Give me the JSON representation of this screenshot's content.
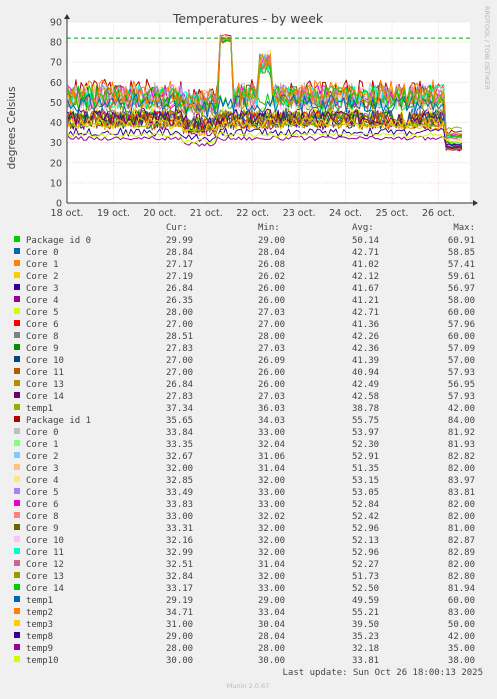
{
  "chart_data": {
    "type": "line",
    "title": "Temperatures - by week",
    "ylabel": "degrees Celsius",
    "xlabel": "",
    "side_label": "RRDTOOL / TOBI OETIKER",
    "ylim": [
      0,
      90
    ],
    "yticks": [
      0,
      10,
      20,
      30,
      40,
      50,
      60,
      70,
      80,
      90
    ],
    "x_ticks": [
      "18 oct.",
      "19 oct.",
      "20 oct.",
      "21 oct.",
      "22 oct.",
      "23 oct.",
      "24 oct.",
      "25 oct.",
      "26 oct."
    ],
    "grid": true,
    "threshold": 82,
    "columns": [
      "",
      "Cur:",
      "Min:",
      "Avg:",
      "Max:"
    ],
    "series": [
      {
        "name": "Package id 0",
        "color": "#00cc00",
        "cur": "29.99",
        "min": "29.00",
        "avg": "50.14",
        "max": "60.91"
      },
      {
        "name": "Core 0",
        "color": "#0066b3",
        "cur": "28.84",
        "min": "28.04",
        "avg": "42.71",
        "max": "58.85"
      },
      {
        "name": "Core 1",
        "color": "#ff8000",
        "cur": "27.17",
        "min": "26.08",
        "avg": "41.02",
        "max": "57.41"
      },
      {
        "name": "Core 2",
        "color": "#ffcc00",
        "cur": "27.19",
        "min": "26.02",
        "avg": "42.12",
        "max": "59.61"
      },
      {
        "name": "Core 3",
        "color": "#330099",
        "cur": "26.84",
        "min": "26.00",
        "avg": "41.67",
        "max": "56.97"
      },
      {
        "name": "Core 4",
        "color": "#990099",
        "cur": "26.35",
        "min": "26.00",
        "avg": "41.21",
        "max": "58.00"
      },
      {
        "name": "Core 5",
        "color": "#ccff00",
        "cur": "28.00",
        "min": "27.03",
        "avg": "42.71",
        "max": "60.00"
      },
      {
        "name": "Core 6",
        "color": "#ff0000",
        "cur": "27.00",
        "min": "27.00",
        "avg": "41.36",
        "max": "57.96"
      },
      {
        "name": "Core 8",
        "color": "#808080",
        "cur": "28.51",
        "min": "28.00",
        "avg": "42.26",
        "max": "60.00"
      },
      {
        "name": "Core 9",
        "color": "#008f00",
        "cur": "27.83",
        "min": "27.03",
        "avg": "42.36",
        "max": "57.09"
      },
      {
        "name": "Core 10",
        "color": "#00487d",
        "cur": "27.00",
        "min": "26.09",
        "avg": "41.39",
        "max": "57.00"
      },
      {
        "name": "Core 11",
        "color": "#b35a00",
        "cur": "27.00",
        "min": "26.00",
        "avg": "40.94",
        "max": "57.93"
      },
      {
        "name": "Core 13",
        "color": "#b38f00",
        "cur": "26.84",
        "min": "26.00",
        "avg": "42.49",
        "max": "56.95"
      },
      {
        "name": "Core 14",
        "color": "#6b006b",
        "cur": "27.83",
        "min": "27.03",
        "avg": "42.58",
        "max": "57.93"
      },
      {
        "name": "temp1",
        "color": "#8fb300",
        "cur": "37.34",
        "min": "36.03",
        "avg": "38.78",
        "max": "42.00"
      },
      {
        "name": "Package id 1",
        "color": "#b30000",
        "cur": "35.65",
        "min": "34.03",
        "avg": "55.75",
        "max": "84.00"
      },
      {
        "name": "Core 0",
        "color": "#bebebe",
        "cur": "33.84",
        "min": "33.00",
        "avg": "53.97",
        "max": "81.92"
      },
      {
        "name": "Core 1",
        "color": "#80ff80",
        "cur": "33.35",
        "min": "32.04",
        "avg": "52.30",
        "max": "81.93"
      },
      {
        "name": "Core 2",
        "color": "#80c9ff",
        "cur": "32.67",
        "min": "31.06",
        "avg": "52.91",
        "max": "82.82"
      },
      {
        "name": "Core 3",
        "color": "#ffc080",
        "cur": "32.00",
        "min": "31.04",
        "avg": "51.35",
        "max": "82.00"
      },
      {
        "name": "Core 4",
        "color": "#ffe680",
        "cur": "32.85",
        "min": "32.00",
        "avg": "53.15",
        "max": "83.97"
      },
      {
        "name": "Core 5",
        "color": "#aa80ff",
        "cur": "33.49",
        "min": "33.00",
        "avg": "53.05",
        "max": "83.81"
      },
      {
        "name": "Core 6",
        "color": "#ee00cc",
        "cur": "33.83",
        "min": "33.00",
        "avg": "52.84",
        "max": "82.00"
      },
      {
        "name": "Core 8",
        "color": "#ff8080",
        "cur": "33.00",
        "min": "32.02",
        "avg": "52.42",
        "max": "82.00"
      },
      {
        "name": "Core 9",
        "color": "#666600",
        "cur": "33.31",
        "min": "32.00",
        "avg": "52.96",
        "max": "81.00"
      },
      {
        "name": "Core 10",
        "color": "#ffbfff",
        "cur": "32.16",
        "min": "32.00",
        "avg": "52.13",
        "max": "82.87"
      },
      {
        "name": "Core 11",
        "color": "#00ffcc",
        "cur": "32.99",
        "min": "32.00",
        "avg": "52.96",
        "max": "82.89"
      },
      {
        "name": "Core 12",
        "color": "#cc6699",
        "cur": "32.51",
        "min": "31.04",
        "avg": "52.27",
        "max": "82.00"
      },
      {
        "name": "Core 13",
        "color": "#999900",
        "cur": "32.84",
        "min": "32.00",
        "avg": "51.73",
        "max": "82.80"
      },
      {
        "name": "Core 14",
        "color": "#00cc00",
        "cur": "33.17",
        "min": "33.00",
        "avg": "52.50",
        "max": "81.94"
      },
      {
        "name": "temp1",
        "color": "#0066b3",
        "cur": "29.19",
        "min": "29.00",
        "avg": "49.59",
        "max": "60.00"
      },
      {
        "name": "temp2",
        "color": "#ff8000",
        "cur": "34.71",
        "min": "33.04",
        "avg": "55.21",
        "max": "83.00"
      },
      {
        "name": "temp3",
        "color": "#ffcc00",
        "cur": "31.00",
        "min": "30.04",
        "avg": "39.50",
        "max": "50.00"
      },
      {
        "name": "temp8",
        "color": "#330099",
        "cur": "29.00",
        "min": "28.04",
        "avg": "35.23",
        "max": "42.00"
      },
      {
        "name": "temp9",
        "color": "#990099",
        "cur": "28.00",
        "min": "28.00",
        "avg": "32.18",
        "max": "35.00"
      },
      {
        "name": "temp10",
        "color": "#ccff00",
        "cur": "30.00",
        "min": "30.00",
        "avg": "33.81",
        "max": "38.00"
      }
    ],
    "last_update": "Last update: Sun Oct 26 18:00:13 2025",
    "footer": "Munin 2.0.67"
  }
}
